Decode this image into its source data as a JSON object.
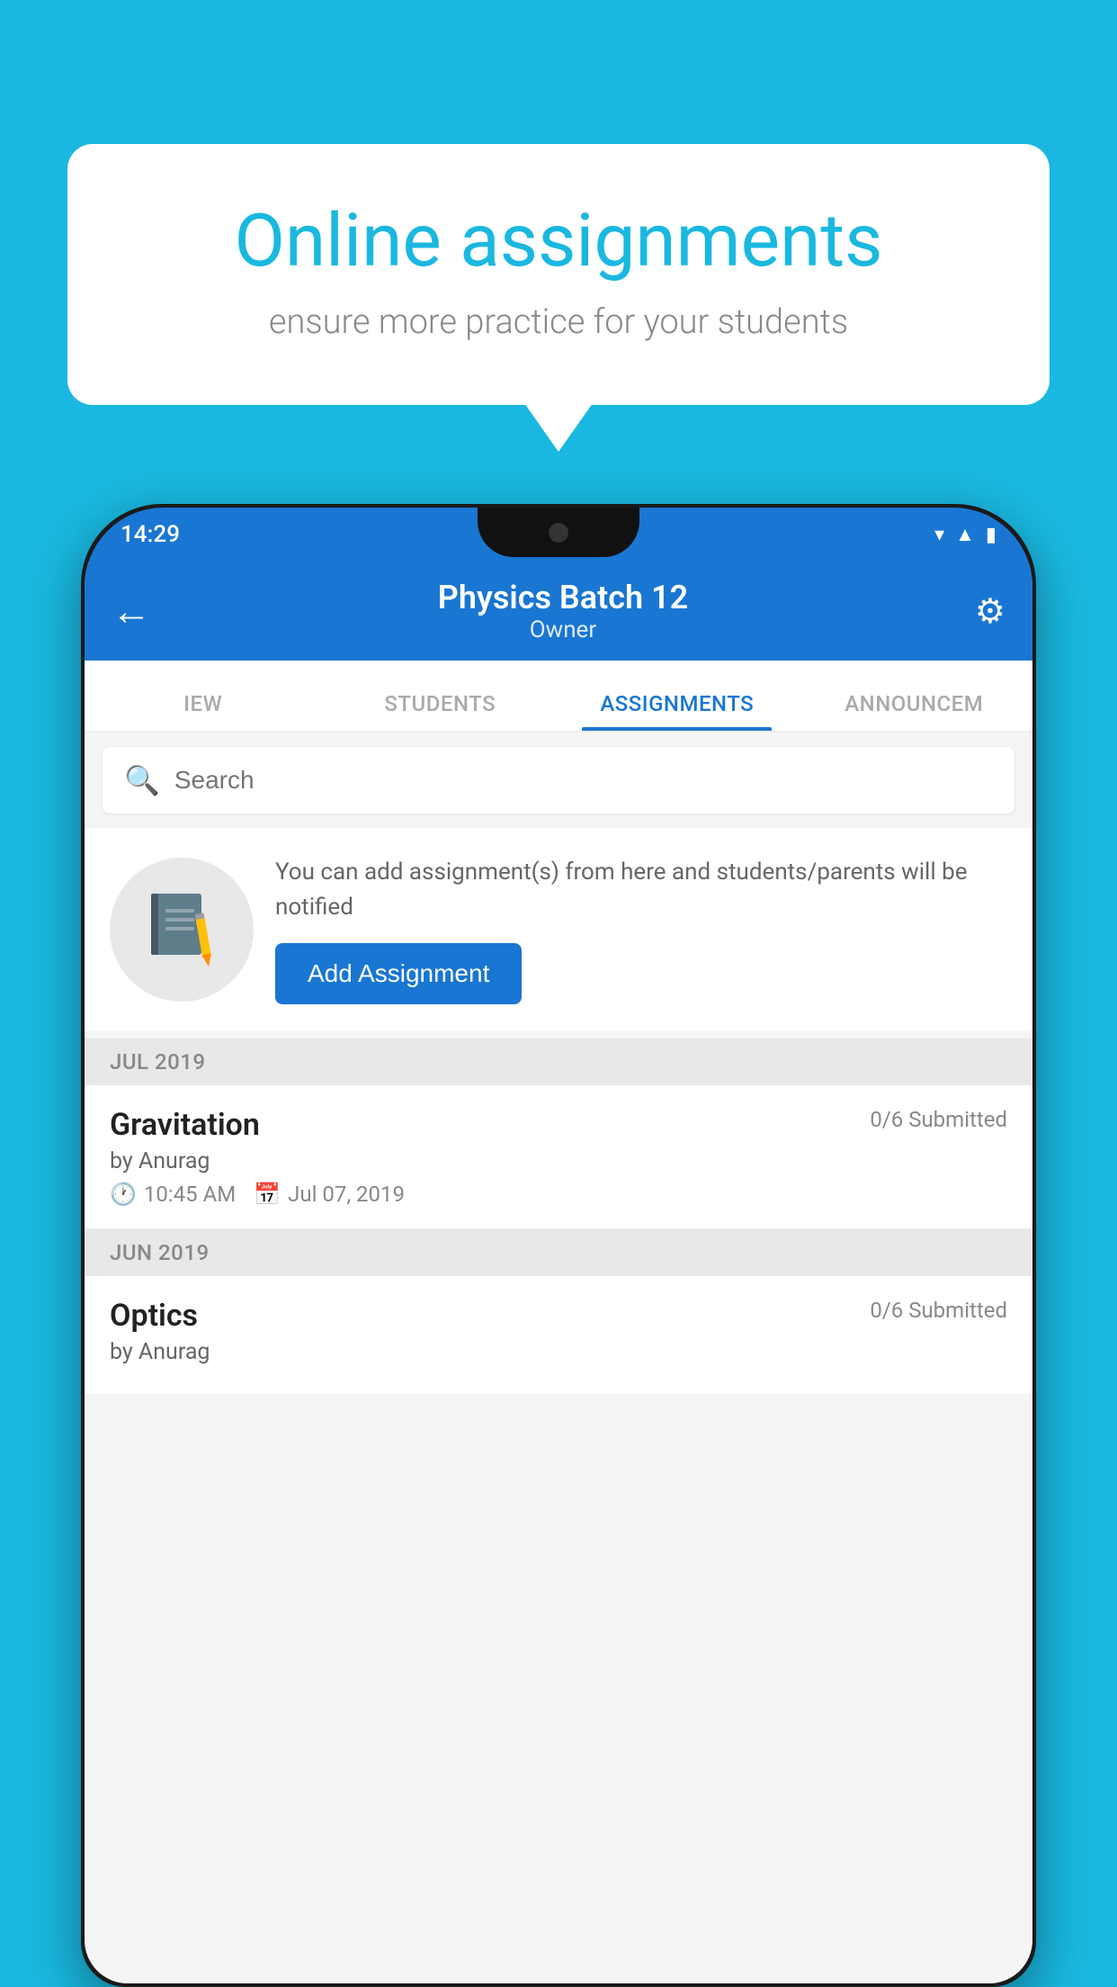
{
  "background_color": "#1ab8e0",
  "speech_bubble": {
    "title": "Online assignments",
    "subtitle": "ensure more practice for your students"
  },
  "status_bar": {
    "time": "14:29",
    "icons": [
      "wifi",
      "signal",
      "battery"
    ]
  },
  "app_bar": {
    "title": "Physics Batch 12",
    "subtitle": "Owner",
    "back_label": "←",
    "settings_label": "⚙"
  },
  "tabs": [
    {
      "label": "IEW",
      "active": false
    },
    {
      "label": "STUDENTS",
      "active": false
    },
    {
      "label": "ASSIGNMENTS",
      "active": true
    },
    {
      "label": "ANNOUNCEMI",
      "active": false
    }
  ],
  "search": {
    "placeholder": "Search"
  },
  "promo": {
    "description": "You can add assignment(s) from here and students/parents will be notified",
    "button_label": "Add Assignment"
  },
  "sections": [
    {
      "header": "JUL 2019",
      "assignments": [
        {
          "name": "Gravitation",
          "submitted": "0/6 Submitted",
          "by": "by Anurag",
          "time": "10:45 AM",
          "date": "Jul 07, 2019"
        }
      ]
    },
    {
      "header": "JUN 2019",
      "assignments": [
        {
          "name": "Optics",
          "submitted": "0/6 Submitted",
          "by": "by Anurag",
          "time": "",
          "date": ""
        }
      ]
    }
  ]
}
